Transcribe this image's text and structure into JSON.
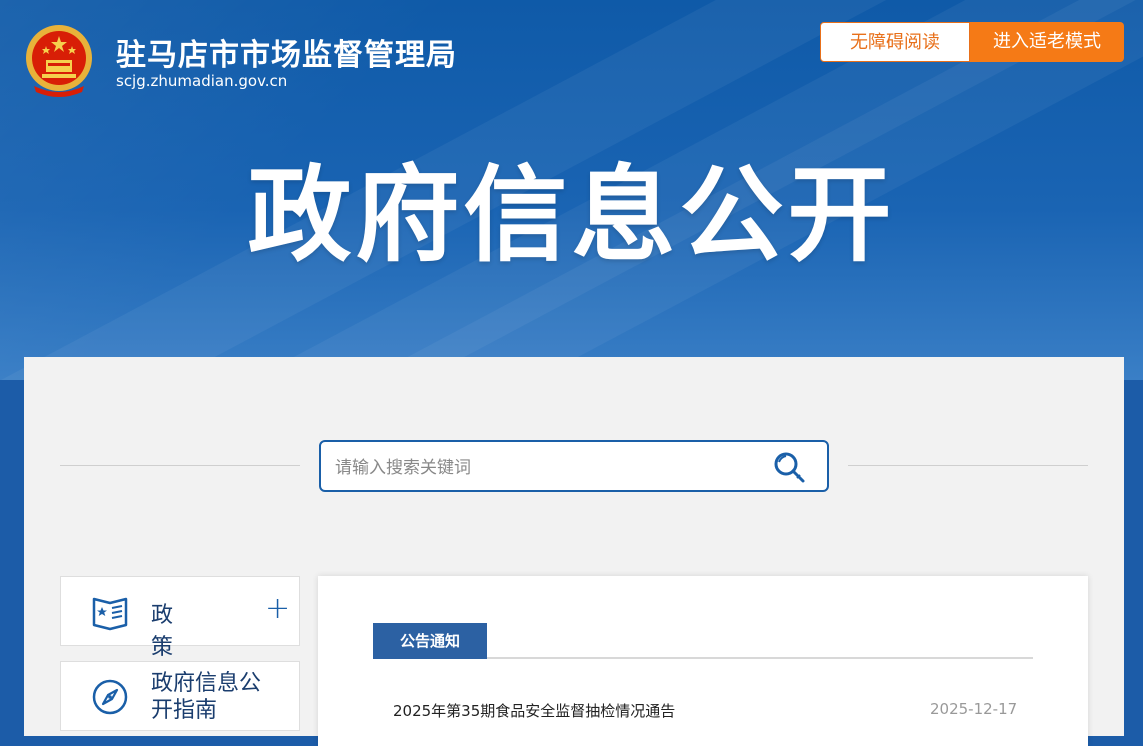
{
  "header": {
    "site_name": "驻马店市市场监督管理局",
    "site_domain": "scjg.zhumadian.gov.cn",
    "accessibility_label": "无障碍阅读",
    "elder_mode_label": "进入适老模式",
    "page_title": "政府信息公开"
  },
  "search": {
    "placeholder": "请输入搜索关键词"
  },
  "sidebar": {
    "items": [
      {
        "label": "政策",
        "icon": "policy-icon",
        "expand": "+"
      },
      {
        "label": "政府信息公开指南",
        "icon": "compass-icon"
      }
    ]
  },
  "main": {
    "tab_label": "公告通知",
    "notices": [
      {
        "title": "2025年第35期食品安全监督抽检情况通告",
        "date": "2025-12-17"
      }
    ]
  },
  "colors": {
    "brand_blue": "#1a5fa8",
    "accent_orange": "#f57a16",
    "tab_blue": "#2c61a3"
  }
}
